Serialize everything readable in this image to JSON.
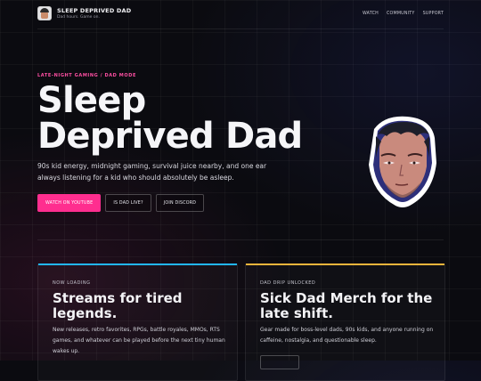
{
  "header": {
    "brand_name": "SLEEP DEPRIVED DAD",
    "tagline": "Dad hours. Game on.",
    "nav": [
      {
        "label": "WATCH"
      },
      {
        "label": "COMMUNITY"
      },
      {
        "label": "SUPPORT"
      }
    ]
  },
  "hero": {
    "eyebrow": "LATE-NIGHT GAMING / DAD MODE",
    "title": "Sleep Deprived Dad",
    "description": "90s kid energy, midnight gaming, survival juice nearby, and one ear always listening for a kid who should absolutely be asleep.",
    "buttons": [
      {
        "label": "WATCH ON YOUTUBE"
      },
      {
        "label": "IS DAD LIVE?"
      },
      {
        "label": "JOIN DISCORD"
      }
    ]
  },
  "cards": [
    {
      "label": "NOW LOADING",
      "title": "Streams for tired legends.",
      "text": "New releases, retro favorites, RPGs, battle royales, MMOs, RTS games, and whatever can be played before the next tiny human wakes up."
    },
    {
      "label": "DAD DRIP UNLOCKED",
      "title": "Sick Dad Merch for the late shift.",
      "text": "Gear made for boss-level dads, 90s kids, and anyone running on caffeine, nostalgia, and questionable sleep."
    }
  ],
  "colors": {
    "accent": "#ff2e8f",
    "card_left_accent": "#22b7ff",
    "card_right_accent": "#f0b53b",
    "background": "#0b0b10"
  }
}
